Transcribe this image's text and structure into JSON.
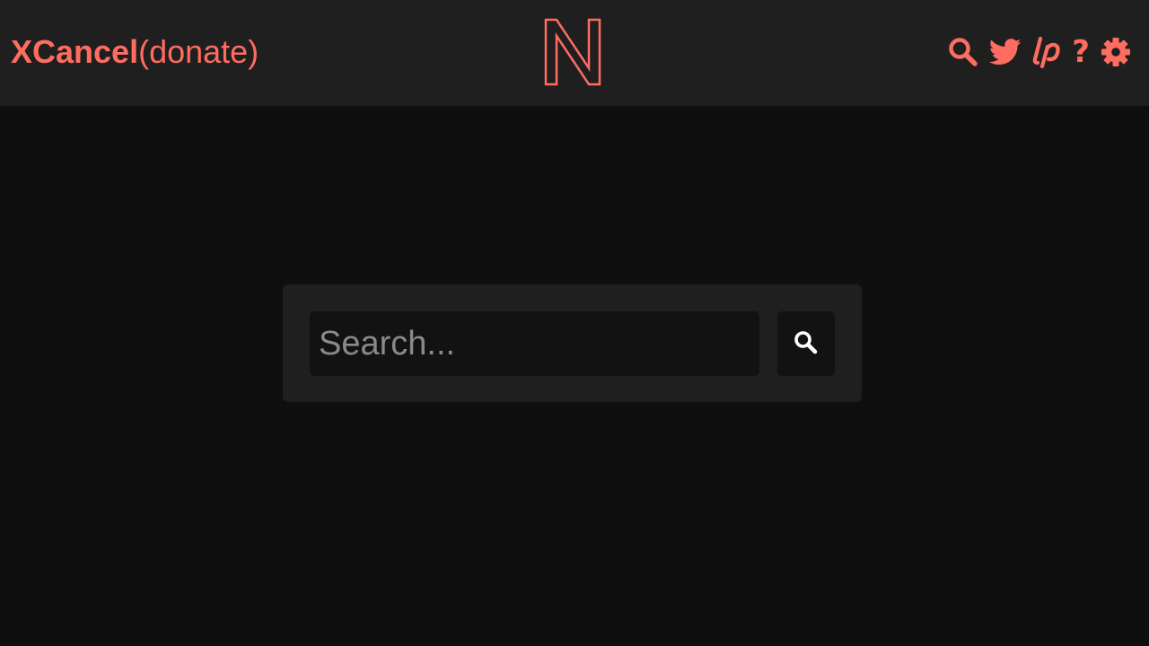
{
  "header": {
    "brand_name": "XCancel",
    "donate_label": "(donate)",
    "icons": [
      "search-icon",
      "twitter-bird-icon",
      "liberapay-icon",
      "help-icon",
      "gear-icon"
    ],
    "help_glyph": "?",
    "accent_color": "#ff6c60",
    "background_color": "#1f1f1f"
  },
  "search": {
    "placeholder": "Search...",
    "value": "",
    "button_icon": "search-icon"
  },
  "page": {
    "background_color": "#0f0f0f"
  }
}
